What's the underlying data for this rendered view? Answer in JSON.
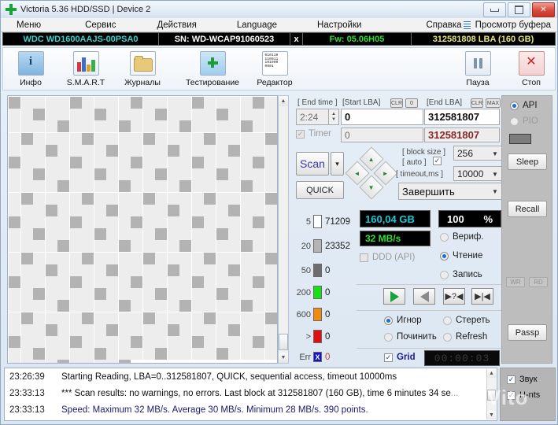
{
  "window": {
    "title": "Victoria 5.36 HDD/SSD | Device 2",
    "minimize": "minimize-icon",
    "maximize": "maximize-icon",
    "close": "✕"
  },
  "menu": {
    "items": [
      "Меню",
      "Сервис",
      "Действия",
      "Language",
      "Настройки",
      "Справка"
    ],
    "buffer_label": "Просмотр буфера"
  },
  "disk_bar": {
    "model": "WDC WD1600AAJS-00PSA0",
    "serial": "SN: WD-WCAP91060523",
    "x": "x",
    "firmware": "Fw: 05.06H05",
    "capacity": "312581808 LBA (160 GB)"
  },
  "toolbar": {
    "buttons": [
      {
        "label": "Инфо",
        "icon": "info-icon"
      },
      {
        "label": "S.M.A.R.T",
        "icon": "smart-chart-icon"
      },
      {
        "label": "Журналы",
        "icon": "folder-icon"
      },
      {
        "label": "Тестирование",
        "icon": "test-plus-icon"
      },
      {
        "label": "Редактор",
        "icon": "binary-editor-icon"
      }
    ],
    "pause": {
      "label": "Пауза",
      "icon": "pause-icon"
    },
    "stop": {
      "label": "Стоп",
      "icon": "stop-x-icon"
    }
  },
  "test_controls": {
    "end_time_label": "[ End time ]",
    "end_time_value": "2:24",
    "timer_label": "Timer",
    "timer_checked": true,
    "start_lba_label": "[Start LBA]",
    "start_lba_clr": "CLR",
    "start_lba_zero": "0",
    "start_lba_value": "0",
    "start_lba_current": "0",
    "end_lba_label": "[End LBA]",
    "end_lba_clr": "CLR",
    "end_lba_max": "MAX",
    "end_lba_value": "312581807",
    "end_lba_current": "312581807",
    "scan_button": "Scan",
    "scan_dropdown": "▾",
    "quick_button": "QUICK",
    "nav": {
      "up": "▲",
      "down": "▼",
      "left": "◄",
      "right": "►"
    },
    "block_size_label": "[ block size ]",
    "block_size_value": "256",
    "auto_label": "[ auto ]",
    "auto_checked": true,
    "timeout_label": "[ timeout,ms ]",
    "timeout_value": "10000",
    "action_select": "Завершить"
  },
  "legend": {
    "rows": [
      {
        "threshold": "5",
        "color": "#ffffff",
        "count": "71209"
      },
      {
        "threshold": "20",
        "color": "#b4b4b4",
        "count": "23352"
      },
      {
        "threshold": "50",
        "color": "#6e6e6e",
        "count": "0"
      },
      {
        "threshold": "200",
        "color": "#18e018",
        "count": "0"
      },
      {
        "threshold": "600",
        "color": "#f08a10",
        "count": "0"
      },
      {
        "threshold": ">",
        "color": "#e01010",
        "count": "0"
      },
      {
        "threshold": "Err",
        "color": "#1414c8",
        "count": "0"
      }
    ]
  },
  "status": {
    "capacity": "160,04 GB",
    "percent_value": "100",
    "percent_unit": "%",
    "speed": "32 MB/s",
    "ddd_label": "DDD (API)",
    "ddd_checked": false,
    "modes": [
      {
        "label": "Вериф.",
        "selected": false
      },
      {
        "label": "Чтение",
        "selected": true
      },
      {
        "label": "Запись",
        "selected": false
      }
    ],
    "nav_buttons": [
      "play-forward-icon",
      "play-backward-icon",
      "seek-random-icon",
      "seek-start-icon"
    ],
    "error_actions": [
      {
        "label": "Игнор",
        "selected": true
      },
      {
        "label": "Стереть",
        "selected": false
      },
      {
        "label": "Починить",
        "selected": false
      },
      {
        "label": "Refresh",
        "selected": false
      }
    ],
    "grid_label": "Grid",
    "grid_checked": true,
    "elapsed": "00:00:03"
  },
  "right_column": {
    "api_label": "API",
    "api_selected": true,
    "pio_label": "PIO",
    "pio_selected": false,
    "sleep_button": "Sleep",
    "recall_button": "Recall",
    "wr_button": "WR",
    "rd_button": "RD",
    "passp_button": "Passp"
  },
  "log": {
    "rows": [
      {
        "time": "23:26:39",
        "text": "Starting Reading, LBA=0..312581807, QUICK, sequential access, timeout 10000ms",
        "style": "dark"
      },
      {
        "time": "23:33:13",
        "text": "*** Scan results: no warnings, no errors. Last block at 312581807 (160 GB), time 6 minutes 34 se...",
        "style": "dark"
      },
      {
        "time": "23:33:13",
        "text": "Speed: Maximum 32 MB/s. Average 30 MB/s. Minimum 28 MB/s. 390 points.",
        "style": "blue"
      }
    ]
  },
  "bottom_right": {
    "sound_label": "Звук",
    "sound_checked": true,
    "hints_label": "H-nts",
    "hints_checked": true
  },
  "watermark": "AVito",
  "colors": {
    "accent_cyan": "#38d3cf",
    "accent_green": "#2ee02e",
    "accent_yellow": "#e7e77a",
    "blue": "#1a6fd4"
  }
}
